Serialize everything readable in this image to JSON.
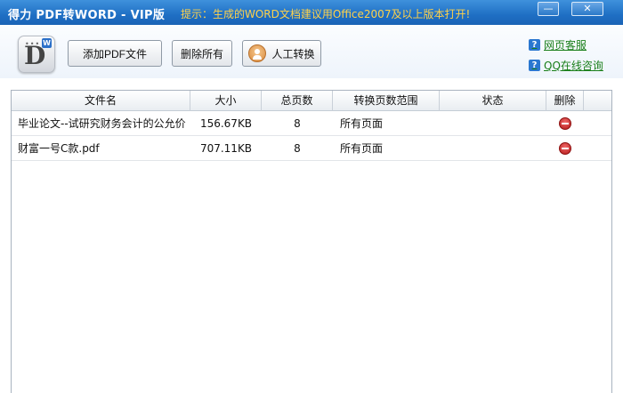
{
  "window": {
    "title": "得力 PDF转WORD - VIP版",
    "tip": "提示：生成的WORD文档建议用Office2007及以上版本打开!",
    "minimize_glyph": "—",
    "close_glyph": "✕"
  },
  "logo": {
    "letter": "D",
    "badge": "W",
    "dots": "•••"
  },
  "toolbar": {
    "add_label": "添加PDF文件",
    "delete_all_label": "删除所有",
    "manual_label": "人工转换"
  },
  "links": {
    "web_service": "网页客服",
    "qq_service": "QQ在线咨询",
    "help_glyph": "?"
  },
  "table": {
    "headers": {
      "name": "文件名",
      "size": "大小",
      "pages": "总页数",
      "range": "转换页数范围",
      "status": "状态",
      "delete": "删除"
    },
    "rows": [
      {
        "name": "毕业论文--试研究财务会计的公允价",
        "size": "156.67KB",
        "pages": "8",
        "range": "所有页面",
        "status": ""
      },
      {
        "name": "财富一号C款.pdf",
        "size": "707.11KB",
        "pages": "8",
        "range": "所有页面",
        "status": ""
      }
    ]
  },
  "colors": {
    "titlebar": "#1f6fc4",
    "tip": "#ffd24a",
    "link": "#1a7f1a",
    "delete_icon": "#c62020"
  }
}
